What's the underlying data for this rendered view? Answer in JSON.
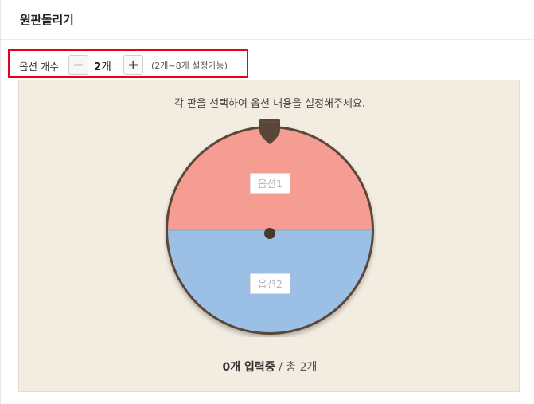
{
  "header": {
    "title": "원판돌리기"
  },
  "option_count": {
    "label": "옵션 개수",
    "value": "2",
    "unit": "개",
    "hint": "(2개~8개 설정가능)",
    "decrement_icon": "minus-icon",
    "increment_icon": "plus-icon"
  },
  "wheel": {
    "instruction": "각 판을 선택하여 옵션 내용을 설정해주세요.",
    "segments": [
      {
        "placeholder": "옵션1",
        "color": "#f59c93"
      },
      {
        "placeholder": "옵션2",
        "color": "#9bbfe5"
      }
    ],
    "rim_color": "#5a4638",
    "pointer_color": "#5a4638"
  },
  "status": {
    "entered_count": "0개 입력중",
    "total": "/ 총 2개"
  }
}
